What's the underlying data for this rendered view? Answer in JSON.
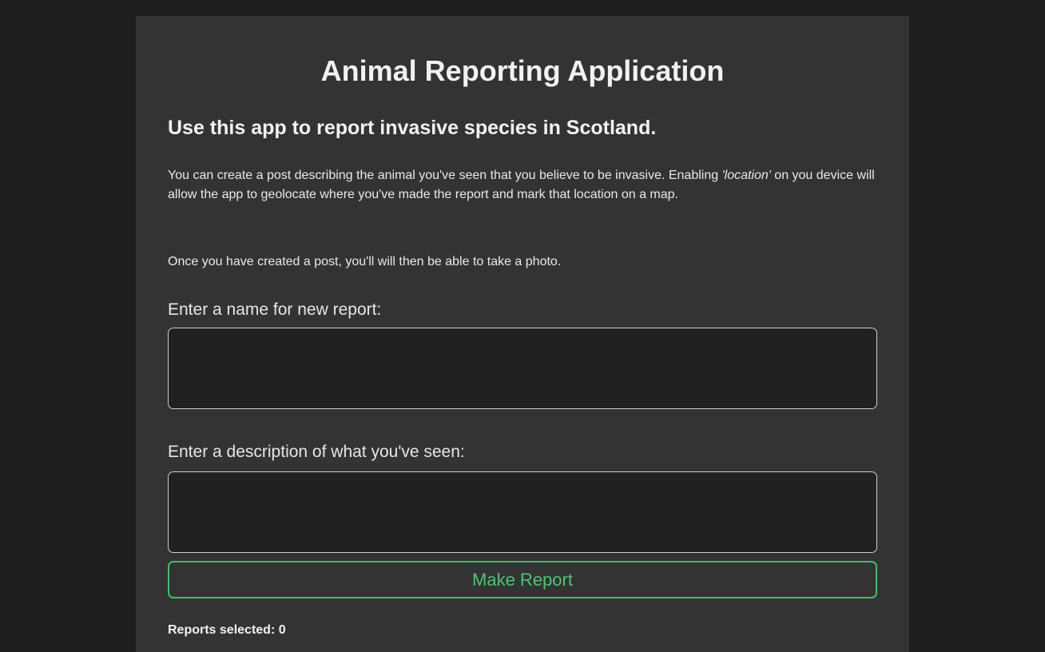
{
  "header": {
    "title": "Animal Reporting Application",
    "subtitle": "Use this app to report invasive species in Scotland."
  },
  "intro": {
    "part1": "You can create a post describing the animal you've seen that you believe to be invasive. Enabling ",
    "emphasis": "'location'",
    "part2": " on you device will allow the app to geolocate where you've made the report and mark that location on a map.",
    "photo_note": "Once you have created a post, you'll will then be able to take a photo."
  },
  "form": {
    "name_label": "Enter a name for new report:",
    "name_value": "",
    "description_label": "Enter a description of what you've seen:",
    "description_value": "",
    "submit_label": "Make Report"
  },
  "status": {
    "reports_selected_label": "Reports selected:",
    "reports_selected_count": "0"
  },
  "colors": {
    "page_background": "#1f1f1f",
    "card_background": "#333333",
    "input_background": "#212121",
    "accent_green": "#47c872"
  }
}
